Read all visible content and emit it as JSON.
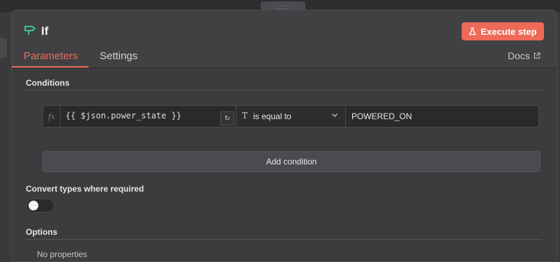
{
  "node": {
    "title": "If",
    "icon": "signpost-icon",
    "execute_label": "Execute step",
    "execute_icon": "flask-icon"
  },
  "tabs": [
    {
      "label": "Parameters",
      "active": true
    },
    {
      "label": "Settings",
      "active": false
    }
  ],
  "docs_label": "Docs",
  "drag_handle_glyph": ":::::",
  "conditions": {
    "section_label": "Conditions",
    "rows": [
      {
        "fx_label": "fx",
        "left_value": "{{ $json.power_state }}",
        "operator_type_glyph": "T",
        "operator": "is equal to",
        "right_value": "POWERED_ON"
      }
    ],
    "add_label": "Add condition"
  },
  "convert_types": {
    "label": "Convert types where required",
    "enabled": false
  },
  "options": {
    "section_label": "Options",
    "empty_text": "No properties"
  },
  "colors": {
    "accent": "#ef6b58",
    "execute_button": "#ee6a57",
    "icon_green": "#3fcf8e",
    "panel_bg": "#414144",
    "content_bg": "#3c3c3f"
  }
}
